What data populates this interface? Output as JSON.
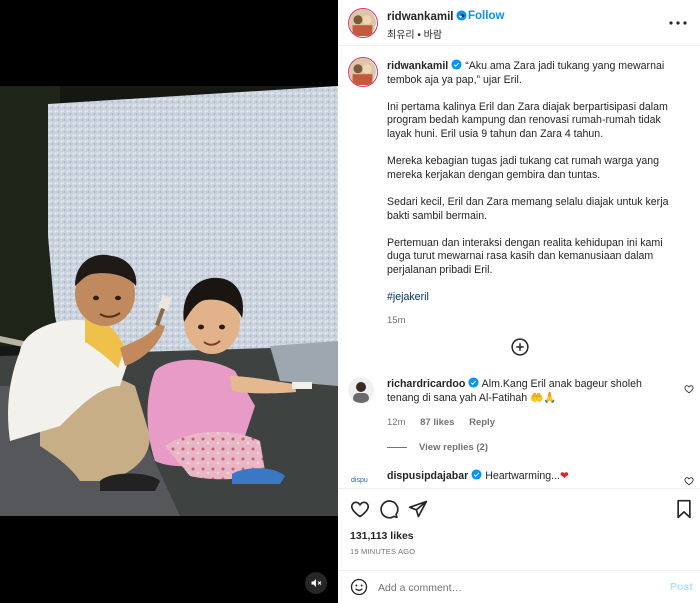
{
  "header": {
    "username": "ridwankamil",
    "follow_label": "Follow",
    "dot": "•",
    "subtitle": "최유리 • 바람"
  },
  "caption": {
    "username": "ridwankamil",
    "paragraphs": [
      "“Aku ama Zara jadi tukang yang mewarnai tembok aja ya pap,” ujar Eril.",
      "Ini pertama kalinya Eril dan Zara diajak berpartisipasi dalam program bedah kampung dan renovasi rumah-rumah tidak layak huni. Eril usia 9 tahun dan Zara 4 tahun.",
      "Mereka kebagian tugas jadi tukang cat rumah warga yang mereka kerjakan dengan gembira dan tuntas.",
      "Sedari kecil, Eril dan Zara memang selalu diajak untuk kerja bakti sambil bermain.",
      "Pertemuan dan interaksi dengan realita kehidupan ini kami duga turut mewarnai rasa kasih dan kemanusiaan dalam perjalanan pribadi Eril."
    ],
    "hashtag": "#jejakeril",
    "time": "15m"
  },
  "comments": [
    {
      "username": "richardricardoo",
      "text": "Alm.Kang Eril anak bageur sholeh tenang di sana yah Al-Fatihah 🤲🙏",
      "time": "12m",
      "likes": "87 likes",
      "reply_label": "Reply",
      "view_replies": "View replies (2)"
    },
    {
      "username": "dispusipdajabar",
      "text": "Heartwarming...",
      "heart_emoji": "❤"
    }
  ],
  "likes": "131,113 likes",
  "date": "15 MINUTES AGO",
  "comment_box": {
    "placeholder": "Add a comment…",
    "post_label": "Post"
  },
  "colors": {
    "accent": "#0095f6",
    "verified": "#0095f6",
    "heart": "#ed1c24",
    "muted": "#737373"
  },
  "icons": [
    "verified-icon",
    "more-options-icon",
    "add-circle-icon",
    "heart-icon",
    "comment-icon",
    "share-icon",
    "save-icon",
    "emoji-icon",
    "mute-icon"
  ]
}
